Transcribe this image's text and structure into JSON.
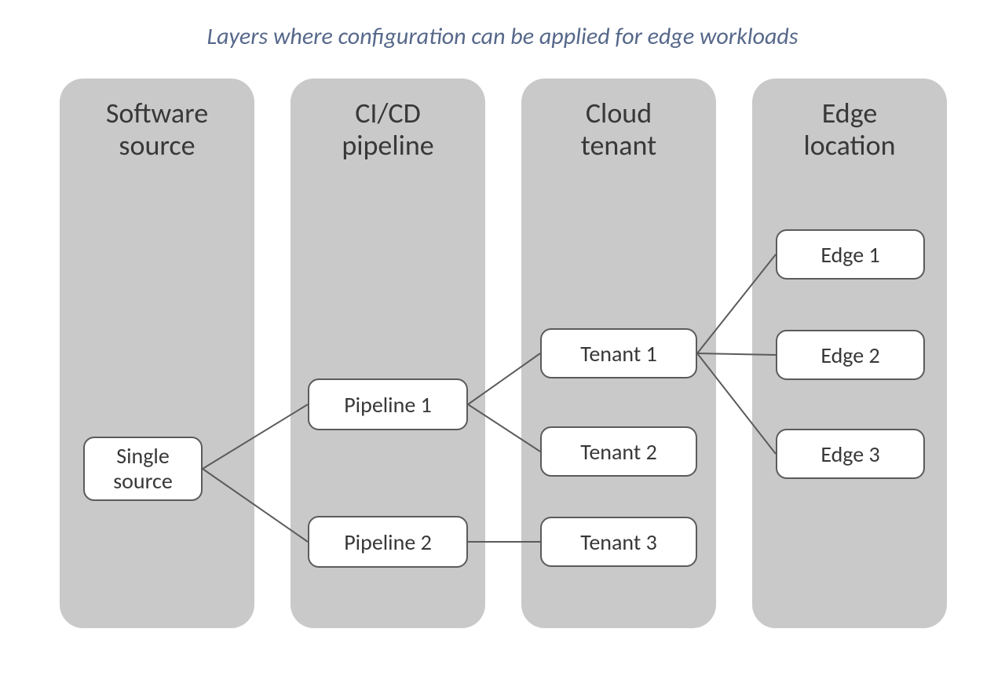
{
  "title": "Layers where configuration can be applied for edge workloads",
  "columns": [
    {
      "header_line1": "Software",
      "header_line2": "source"
    },
    {
      "header_line1": "CI/CD",
      "header_line2": "pipeline"
    },
    {
      "header_line1": "Cloud",
      "header_line2": "tenant"
    },
    {
      "header_line1": "Edge",
      "header_line2": "location"
    }
  ],
  "nodes": {
    "single_source_l1": "Single",
    "single_source_l2": "source",
    "pipeline1": "Pipeline 1",
    "pipeline2": "Pipeline 2",
    "tenant1": "Tenant 1",
    "tenant2": "Tenant 2",
    "tenant3": "Tenant 3",
    "edge1": "Edge 1",
    "edge2": "Edge 2",
    "edge3": "Edge 3"
  },
  "edges": [
    [
      "single_source",
      "pipeline1"
    ],
    [
      "single_source",
      "pipeline2"
    ],
    [
      "pipeline1",
      "tenant1"
    ],
    [
      "pipeline1",
      "tenant2"
    ],
    [
      "pipeline2",
      "tenant3"
    ],
    [
      "tenant1",
      "edge1"
    ],
    [
      "tenant1",
      "edge2"
    ],
    [
      "tenant1",
      "edge3"
    ]
  ]
}
